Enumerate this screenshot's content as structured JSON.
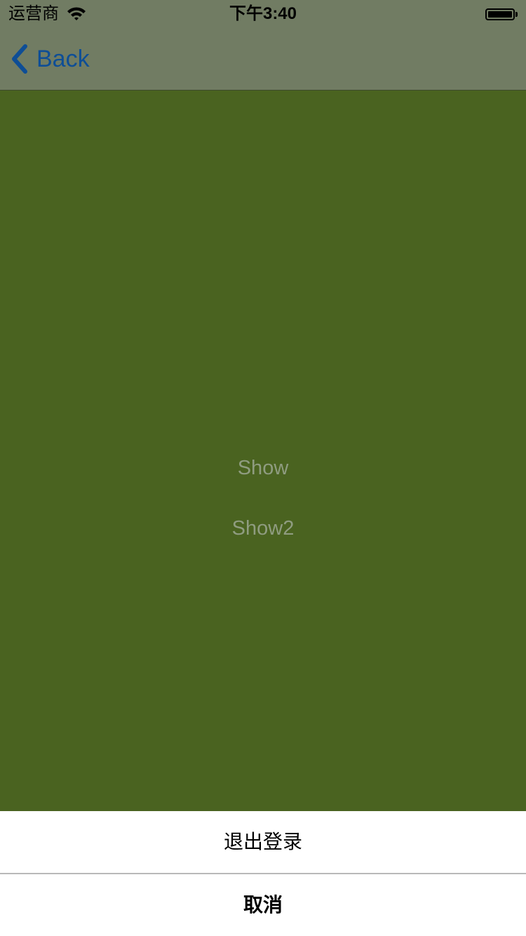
{
  "status_bar": {
    "carrier": "运营商",
    "time": "下午3:40",
    "wifi_icon": "wifi-icon",
    "battery_icon": "battery-icon",
    "battery_level": 1.0
  },
  "nav_bar": {
    "back_label": "Back",
    "back_icon": "chevron-left-icon",
    "tint_color": "#0e4e96",
    "background_color": "#717c63"
  },
  "main": {
    "background_color": "#4a6320",
    "buttons": [
      {
        "label": "Show"
      },
      {
        "label": "Show2"
      }
    ],
    "button_text_color": "#8f9c80"
  },
  "action_sheet": {
    "items": [
      {
        "label": "退出登录"
      }
    ],
    "cancel_label": "取消",
    "background_color": "#ffffff"
  }
}
